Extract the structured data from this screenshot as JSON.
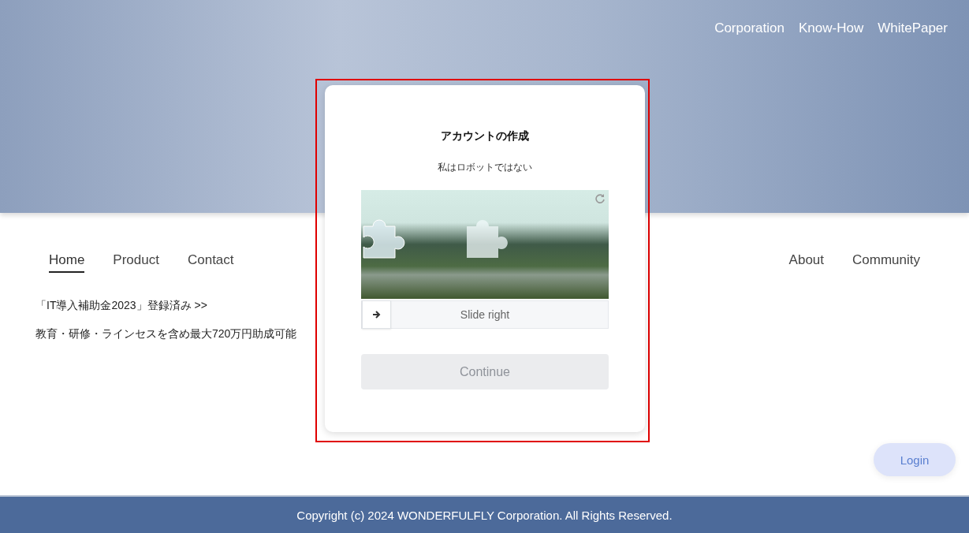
{
  "top_nav": [
    {
      "label": "Corporation"
    },
    {
      "label": "Know-How"
    },
    {
      "label": "WhitePaper"
    }
  ],
  "main_nav_left": [
    {
      "label": "Home",
      "selected": true
    },
    {
      "label": "Product",
      "selected": false
    },
    {
      "label": "Contact",
      "selected": false
    }
  ],
  "main_nav_right": [
    {
      "label": "About",
      "selected": false
    },
    {
      "label": "Community",
      "selected": false
    }
  ],
  "promo": {
    "link": "「IT導入補助金2023」登録済み >>",
    "text": "教育・研修・ラインセスを含め最大720万円助成可能"
  },
  "modal": {
    "title": "アカウントの作成",
    "subtitle": "私はロボットではない",
    "slider": {
      "label": "Slide right",
      "level": 0
    },
    "continue": {
      "label": "Continue",
      "disabled": true
    }
  },
  "login": {
    "label": "Login"
  },
  "footer": {
    "text": "Copyright (c) 2024 WONDERFULFLY Corporation. All Rights Reserved."
  }
}
